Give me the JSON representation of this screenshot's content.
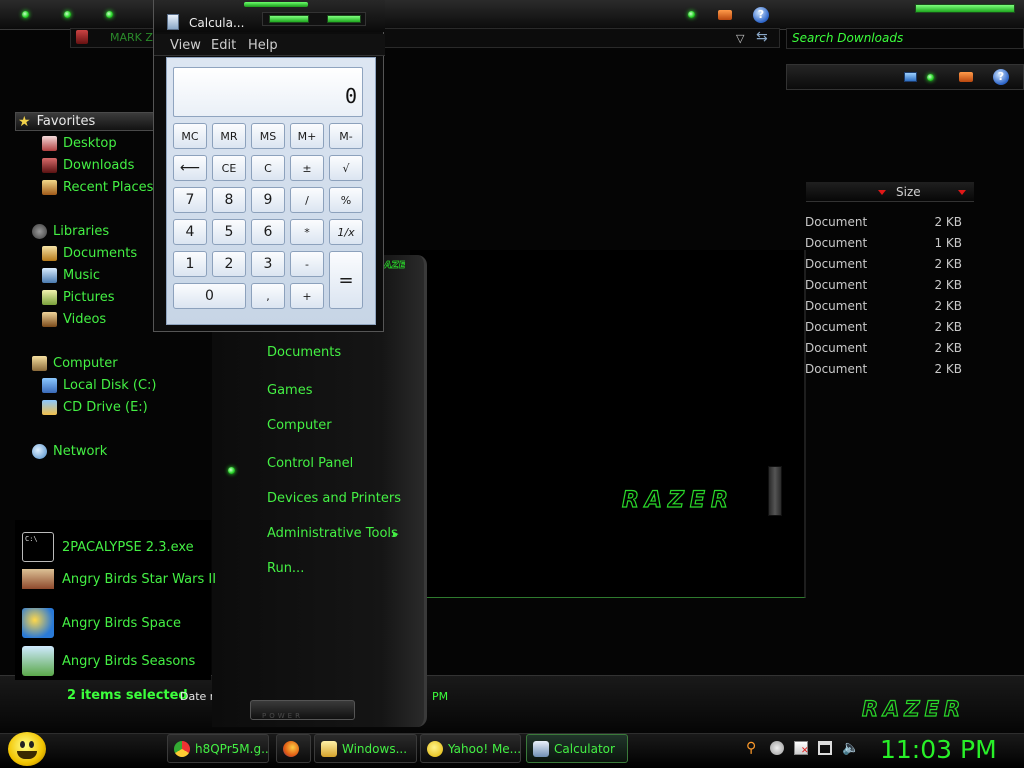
{
  "explorer": {
    "breadcrumb_partial": "MARK Z",
    "search_placeholder": "Search Downloads",
    "nav": {
      "favorites": "Favorites",
      "favorites_items": [
        "Desktop",
        "Downloads",
        "Recent Places"
      ],
      "libraries": "Libraries",
      "libraries_items": [
        "Documents",
        "Music",
        "Pictures",
        "Videos"
      ],
      "computer": "Computer",
      "computer_items": [
        "Local Disk (C:)",
        "CD Drive (E:)"
      ],
      "network": "Network"
    },
    "columns": {
      "size": "Size"
    },
    "files": [
      {
        "type": "Document",
        "size": "2 KB"
      },
      {
        "type": "Document",
        "size": "1 KB"
      },
      {
        "type": "Document",
        "size": "2 KB"
      },
      {
        "type": "Document",
        "size": "2 KB"
      },
      {
        "type": "Document",
        "size": "2 KB"
      },
      {
        "type": "Document",
        "size": "2 KB"
      },
      {
        "type": "Document",
        "size": "2 KB"
      },
      {
        "type": "Document",
        "size": "2 KB"
      }
    ],
    "status": {
      "selected": "2 items selected",
      "date_modified_label": "Date modified:",
      "time_fragment": "PM"
    }
  },
  "start_menu": {
    "programs": [
      "2PACALYPSE 2.3.exe",
      "Angry Birds Star Wars II",
      "Angry Birds Space",
      "Angry Birds Seasons"
    ],
    "right_items": [
      "Documents",
      "Games",
      "Computer",
      "Control Panel",
      "Devices and Printers",
      "Administrative Tools",
      "Run..."
    ],
    "power_label": "POWER",
    "submenu_arrow": "▸"
  },
  "razer_brand": "RAZER",
  "calculator": {
    "title": "Calcula...",
    "menus": [
      "View",
      "Edit",
      "Help"
    ],
    "display": "0",
    "buttons": {
      "mc": "MC",
      "mr": "MR",
      "ms": "MS",
      "mplus": "M+",
      "mminus": "M-",
      "back": "⟵",
      "ce": "CE",
      "c": "C",
      "plusminus": "±",
      "sqrt": "√",
      "n7": "7",
      "n8": "8",
      "n9": "9",
      "div": "/",
      "pct": "%",
      "n4": "4",
      "n5": "5",
      "n6": "6",
      "mul": "*",
      "recip": "1/x",
      "n1": "1",
      "n2": "2",
      "n3": "3",
      "sub": "-",
      "eq": "=",
      "n0": "0",
      "dot": ",",
      "add": "+"
    }
  },
  "taskbar": {
    "items": [
      {
        "label": "h8QPr5M.g...",
        "icon": "chrome-icon"
      },
      {
        "label": "",
        "icon": "firefox-icon"
      },
      {
        "label": "Windows...",
        "icon": "folder-icon"
      },
      {
        "label": "Yahoo! Me...",
        "icon": "yahoo-messenger-icon"
      },
      {
        "label": "Calculator",
        "icon": "calculator-icon"
      }
    ],
    "clock": "11:03 PM"
  },
  "colors": {
    "accent": "#44f044",
    "background": "#000000",
    "alert": "#e01818"
  }
}
